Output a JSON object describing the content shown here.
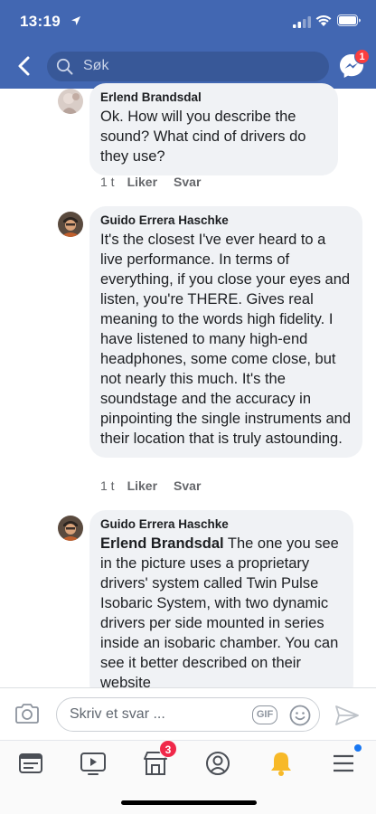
{
  "status_bar": {
    "time": "13:19"
  },
  "header": {
    "search_placeholder": "Søk",
    "messenger_badge": "1"
  },
  "comments": [
    {
      "author": "Erlend Brandsdal",
      "text": "Ok. How will you describe the sound? What cind of drivers do they use?",
      "time": "1 t",
      "like_label": "Liker",
      "reply_label": "Svar"
    },
    {
      "author": "Guido Errera Haschke",
      "text": "It's the closest I've ever heard to a live performance. In terms of everything, if you close your eyes and listen, you're THERE. Gives real meaning to the words high fidelity. I have listened to many high-end headphones, some come close, but not nearly this much. It's the soundstage and the accuracy in pinpointing the single instruments and their location that is truly astounding.",
      "time": "1 t",
      "like_label": "Liker",
      "reply_label": "Svar"
    },
    {
      "author": "Guido Errera Haschke",
      "mention": "Erlend Brandsdal",
      "text": " The one you see in the picture uses a proprietary drivers' system called Twin Pulse Isobaric System, with two dynamic drivers per side mounted in series inside an isobaric chamber. You can see it better described on their website"
    }
  ],
  "composer": {
    "placeholder": "Skriv et svar ...",
    "gif_label": "GIF"
  },
  "tabbar": {
    "marketplace_badge": "3"
  }
}
